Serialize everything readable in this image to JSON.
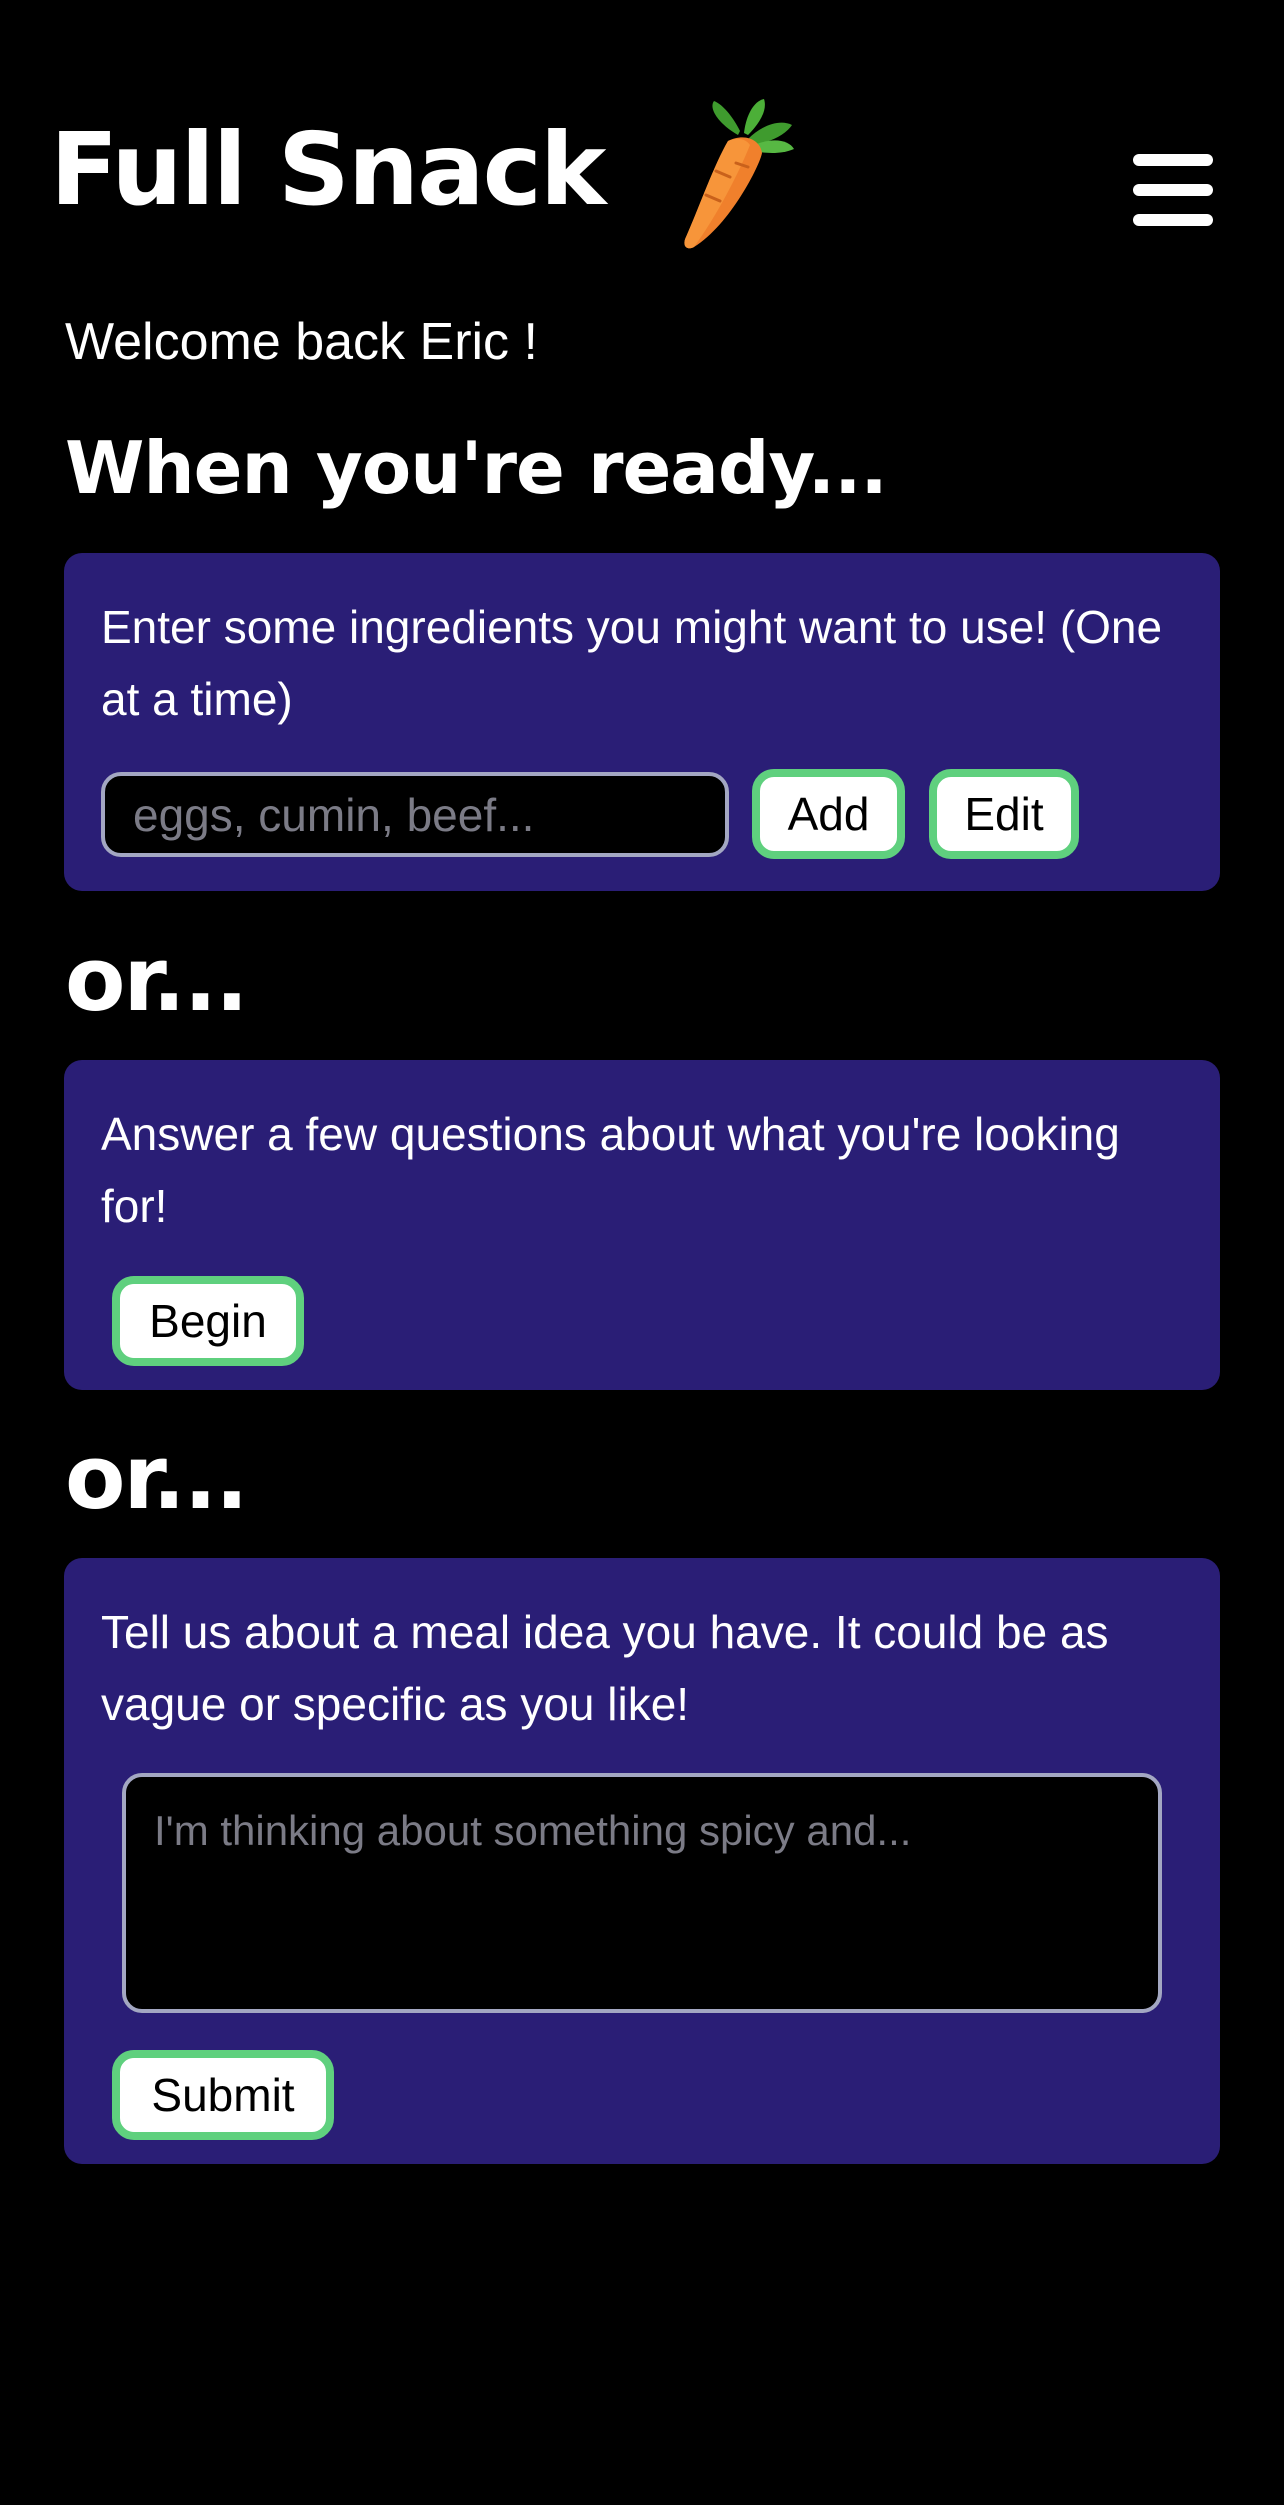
{
  "header": {
    "app_title": "Full Snack",
    "logo_icon": "carrot-icon",
    "menu_icon": "hamburger-menu-icon"
  },
  "welcome_text": "Welcome back Eric !",
  "section_heading": "When you're ready...",
  "ingredients_card": {
    "instruction": "Enter some ingredients you might want to use! (One at a time)",
    "input_value": "",
    "input_placeholder": "eggs, cumin, beef...",
    "add_label": "Add",
    "edit_label": "Edit"
  },
  "or_label_1": "or...",
  "questions_card": {
    "instruction": "Answer a few questions about what you're looking for!",
    "begin_label": "Begin"
  },
  "or_label_2": "or...",
  "meal_idea_card": {
    "instruction": "Tell us about a meal idea you have. It could be as vague or specific as you like!",
    "textarea_value": "",
    "textarea_placeholder": "I'm thinking about something spicy and...",
    "submit_label": "Submit"
  },
  "colors": {
    "background": "#000000",
    "card": "#2a1e76",
    "button_border": "#5fd07e",
    "input_border": "#a3a7c2"
  }
}
